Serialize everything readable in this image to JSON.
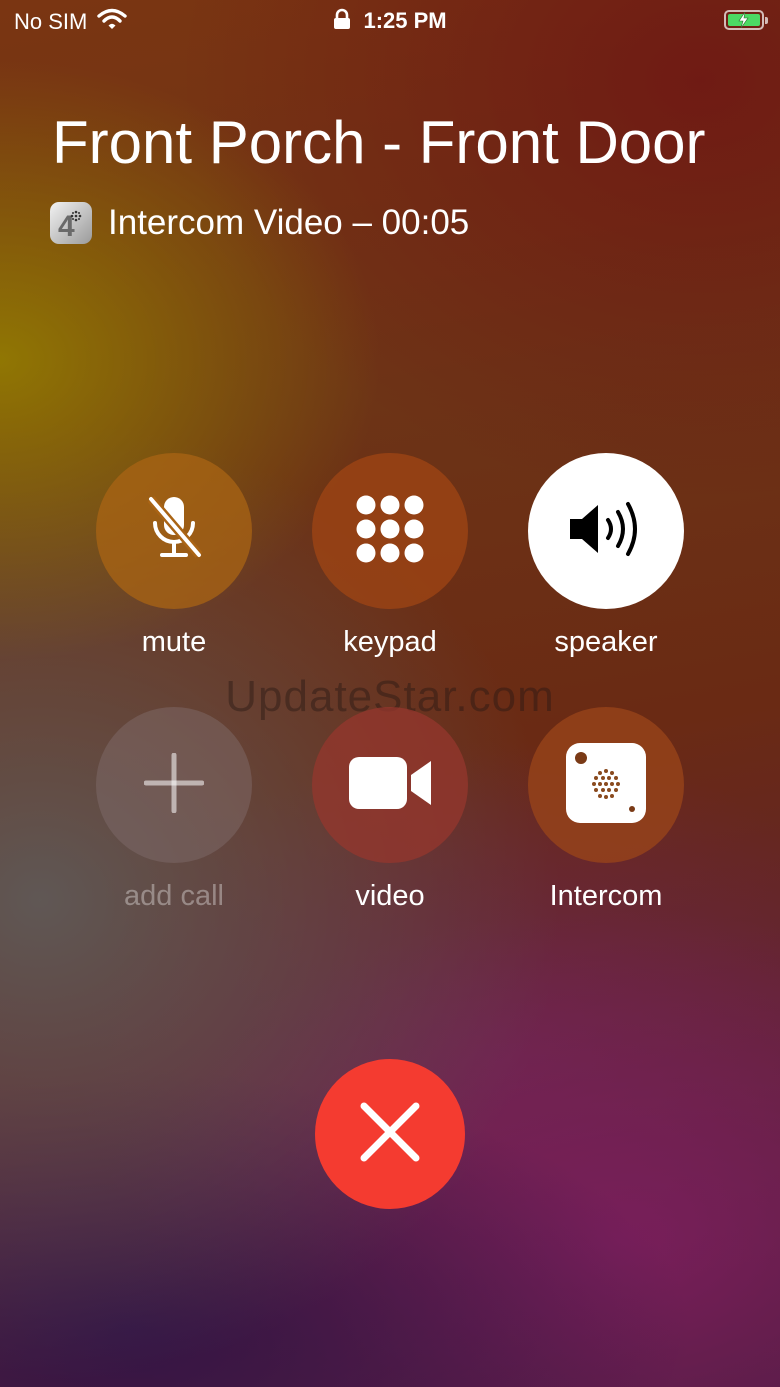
{
  "status_bar": {
    "carrier": "No SIM",
    "time": "1:25 PM",
    "icons": [
      "wifi-icon",
      "lock-icon",
      "battery-charging-icon"
    ]
  },
  "call": {
    "caller_name": "Front Porch - Front Door",
    "subtitle": "Intercom Video – 00:05",
    "app_icon": "intercom-app-icon"
  },
  "watermark": "UpdateStar.com",
  "controls": [
    {
      "label": "mute",
      "icon": "mic-slash-icon",
      "state": "off"
    },
    {
      "label": "keypad",
      "icon": "keypad-icon",
      "state": "off"
    },
    {
      "label": "speaker",
      "icon": "speaker-icon",
      "state": "on"
    },
    {
      "label": "add call",
      "icon": "plus-icon",
      "state": "disabled"
    },
    {
      "label": "video",
      "icon": "video-camera-icon",
      "state": "off"
    },
    {
      "label": "Intercom",
      "icon": "intercom-icon",
      "state": "off"
    }
  ],
  "end_call": {
    "icon": "close-icon"
  },
  "colors": {
    "end_call": "#f43b30",
    "speaker_active": "#ffffff",
    "battery": "#4cd964"
  }
}
